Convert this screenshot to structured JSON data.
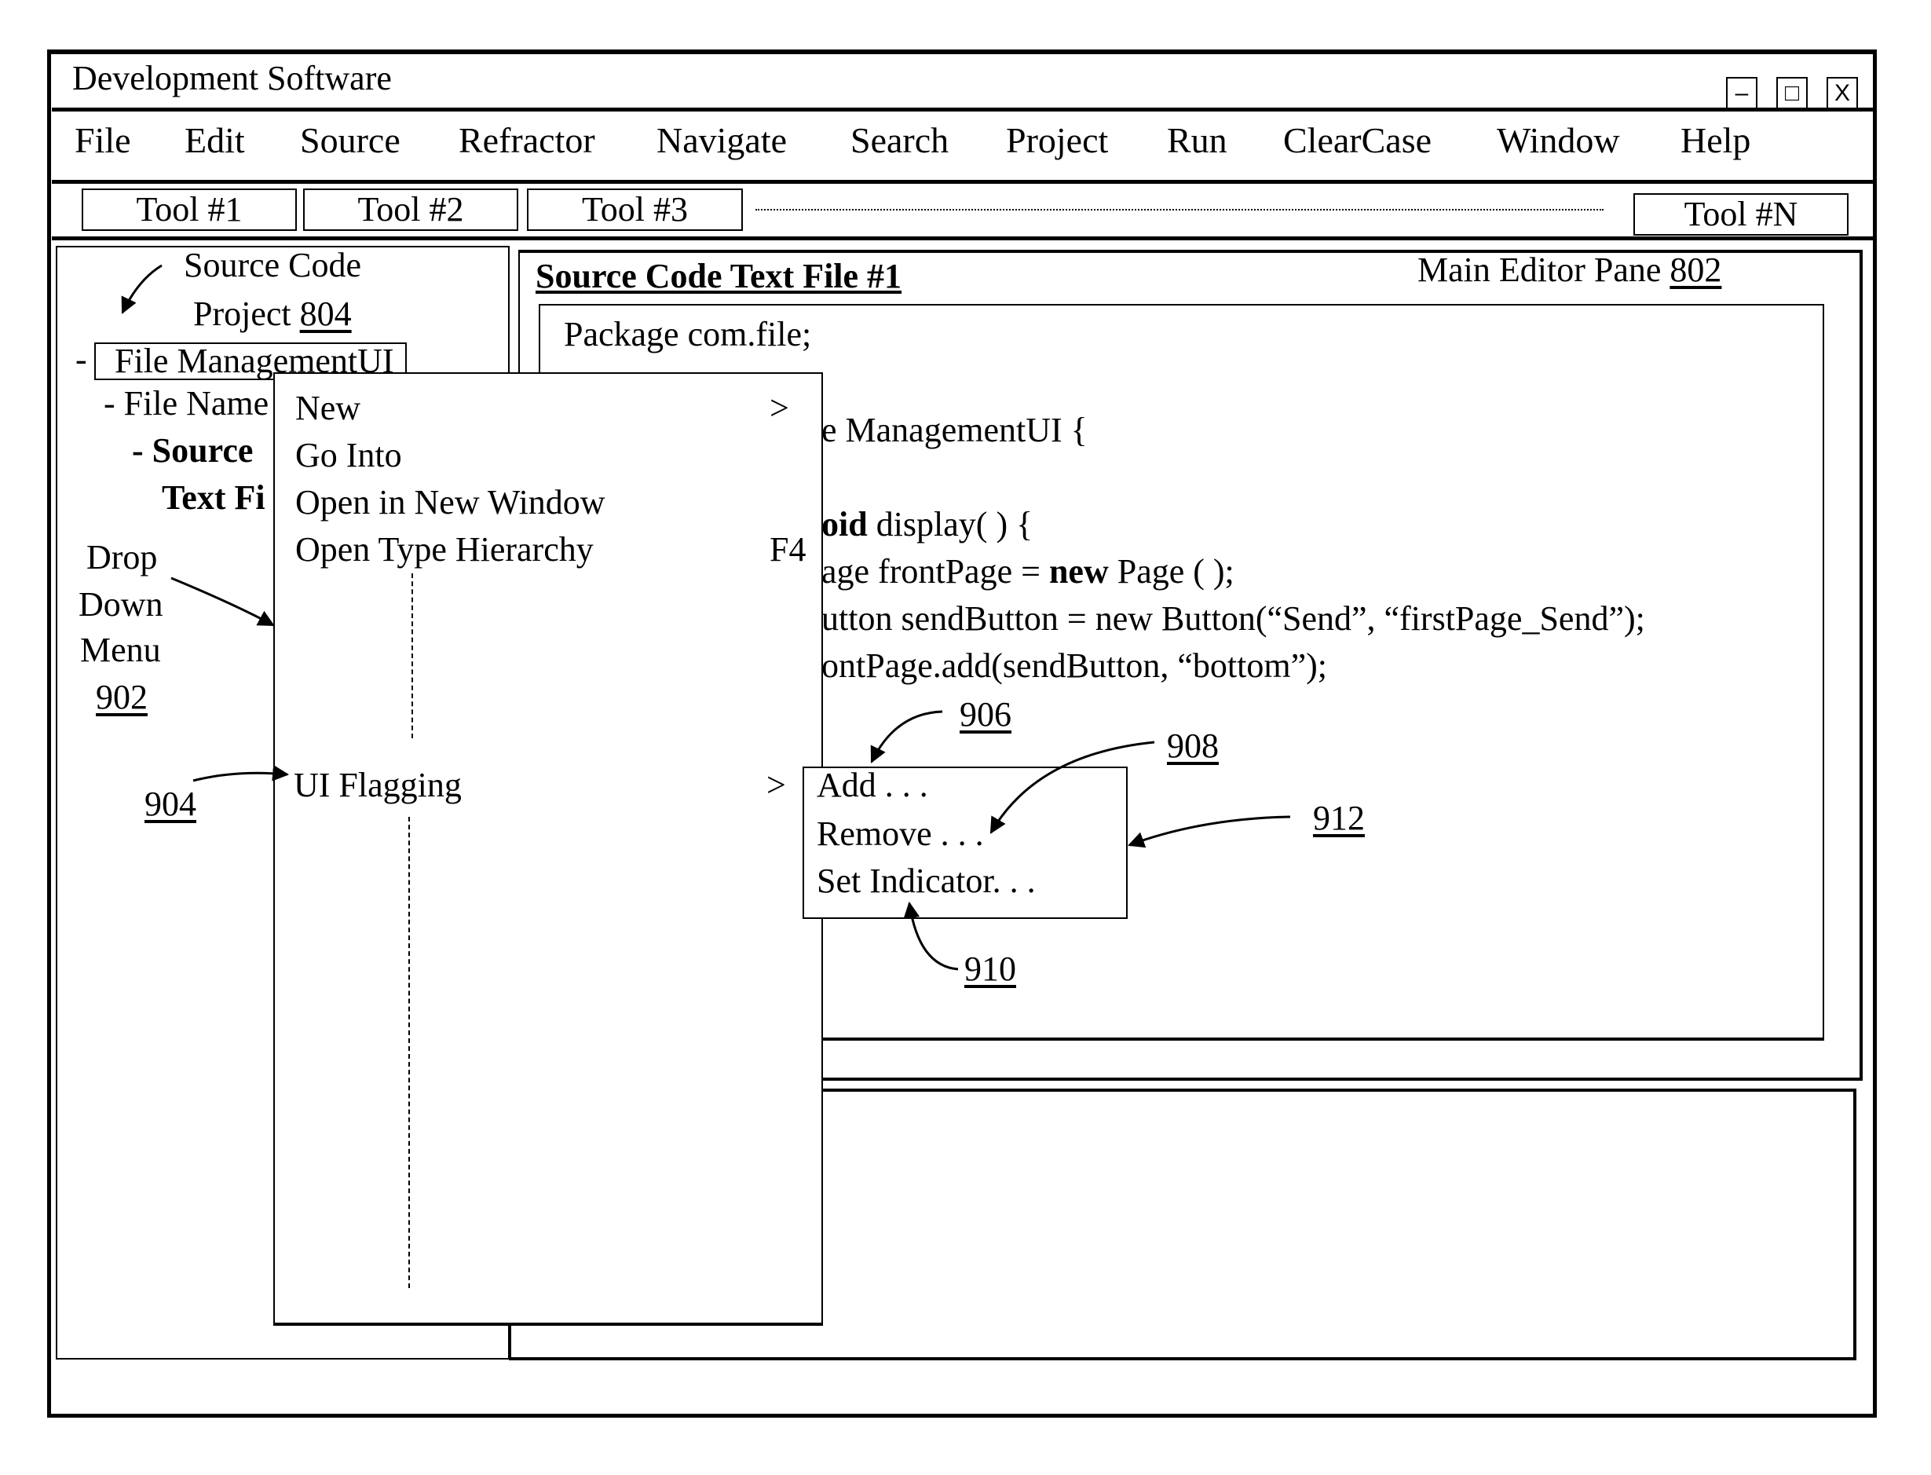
{
  "window": {
    "title": "Development Software",
    "controls": {
      "minimize": "–",
      "maximize": "□",
      "close": "X"
    }
  },
  "menubar": {
    "items": [
      "File",
      "Edit",
      "Source",
      "Refractor",
      "Navigate",
      "Search",
      "Project",
      "Run",
      "ClearCase",
      "Window",
      "Help"
    ]
  },
  "toolbar": {
    "tools": [
      "Tool #1",
      "Tool #2",
      "Tool #3"
    ],
    "last_tool": "Tool #N"
  },
  "project_pane": {
    "label_line1": "Source Code",
    "label_line2": "Project ",
    "ref": "804",
    "tree": {
      "root_prefix": "-",
      "root": "File ManagementUI",
      "child": "- File Name",
      "grandchild_line1": "- Source",
      "grandchild_line2": "Text Fi"
    }
  },
  "editor": {
    "tab_title": "Source Code Text File #1",
    "pane_label": "Main Editor Pane ",
    "pane_ref": "802",
    "code": {
      "line1": "Package com.file;",
      "line2": "e ManagementUI {",
      "line3_bold": "oid",
      "line3_rest": " display( )   {",
      "line4_a": "age frontPage = ",
      "line4_bold": "new",
      "line4_b": " Page ( );",
      "line5": "utton sendButton = new Button(“Send”, “firstPage_Send”);",
      "line6": "ontPage.add(sendButton, “bottom”);"
    }
  },
  "dropdown_menu": {
    "items": [
      {
        "label": "New",
        "suffix": ">"
      },
      {
        "label": "Go Into",
        "suffix": ""
      },
      {
        "label": "Open in New Window",
        "suffix": ""
      },
      {
        "label": "Open Type Hierarchy",
        "suffix": "F4"
      }
    ],
    "flag_item": {
      "label": "UI Flagging",
      "suffix": ">"
    }
  },
  "submenu": {
    "items": [
      "Add . . .",
      "Remove . . .",
      "Set Indicator. . ."
    ]
  },
  "callouts": {
    "dropdown_label": [
      "Drop",
      "Down",
      "Menu"
    ],
    "dropdown_ref": "902",
    "flag_ref": "904",
    "add_ref": "906",
    "remove_ref": "908",
    "indicator_ref": "910",
    "submenu_ref": "912"
  }
}
